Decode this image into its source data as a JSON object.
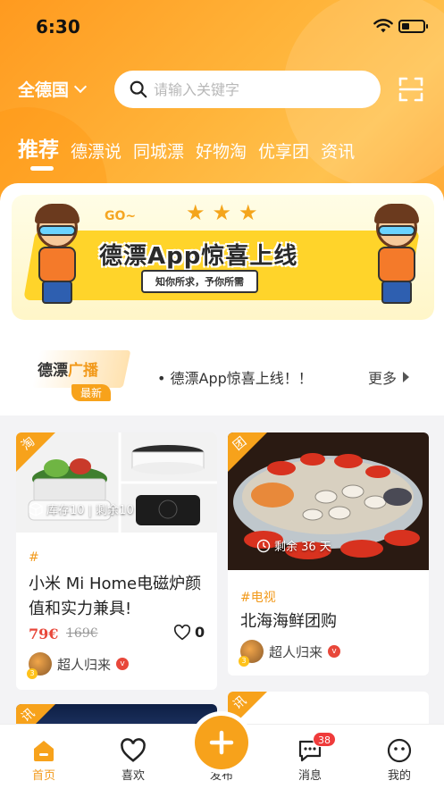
{
  "status": {
    "time": "6:30"
  },
  "header": {
    "region": "全德国",
    "search_placeholder": "请输入关键字"
  },
  "tabs": [
    {
      "label": "推荐",
      "active": true
    },
    {
      "label": "德漂说"
    },
    {
      "label": "同城漂"
    },
    {
      "label": "好物淘"
    },
    {
      "label": "优享团"
    },
    {
      "label": "资讯"
    }
  ],
  "banner": {
    "title": "德漂App惊喜上线",
    "subtitle": "知你所求，予你所需",
    "go": "GO~",
    "stars": "★★★"
  },
  "news": {
    "logo_prefix": "德漂",
    "logo_suffix": "广播",
    "logo_badge": "最新",
    "headline": "• 德漂App惊喜上线！！",
    "more": "更多"
  },
  "cards": [
    {
      "corner": "淘",
      "overlay": "库存10 | 剩余10",
      "tag": "#",
      "title": "小米 Mi Home电磁炉颜值和实力兼具!",
      "price": "79€",
      "old_price": "169€",
      "likes": "0",
      "author": "超人归来",
      "level": "3"
    },
    {
      "corner": "团",
      "overlay": "剩余 36 天",
      "tag": "#电视",
      "title": "北海海鲜团购",
      "author": "超人归来",
      "level": "3"
    },
    {
      "corner": "讯"
    },
    {
      "corner": "讯"
    }
  ],
  "nav": [
    {
      "label": "首页",
      "active": true
    },
    {
      "label": "喜欢"
    },
    {
      "label": "发布"
    },
    {
      "label": "消息",
      "badge": "38"
    },
    {
      "label": "我的"
    }
  ],
  "colors": {
    "accent": "#f7a21b",
    "price": "#e8473a"
  }
}
